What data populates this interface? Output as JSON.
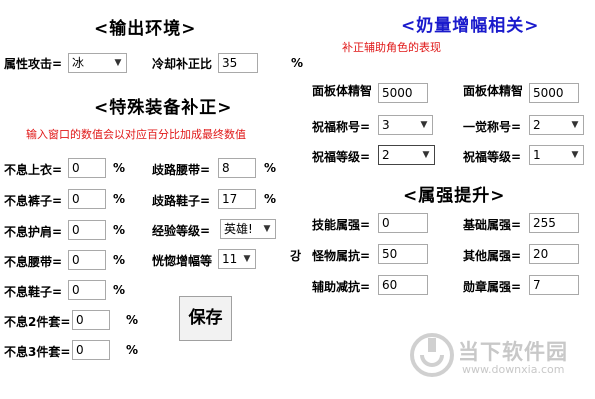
{
  "left": {
    "output_env_title": "<输出环境>",
    "attr_attack_label": "属性攻击=",
    "attr_attack_value": "冰",
    "cooldown_label": "冷却补正比",
    "cooldown_value": "35",
    "cooldown_unit": "%",
    "special_title": "<特殊装备补正>",
    "hint": "输入窗口的数值会以对应百分比加成最终数值",
    "rows": [
      {
        "label": "不息上衣=",
        "value": "0",
        "unit": "%"
      },
      {
        "label": "不息裤子=",
        "value": "0",
        "unit": "%"
      },
      {
        "label": "不息护肩=",
        "value": "0",
        "unit": "%"
      },
      {
        "label": "不息腰带=",
        "value": "0",
        "unit": "%"
      },
      {
        "label": "不息鞋子=",
        "value": "0",
        "unit": "%"
      },
      {
        "label": "不息2件套=",
        "value": "0",
        "unit": "%"
      },
      {
        "label": "不息3件套=",
        "value": "0",
        "unit": "%"
      }
    ],
    "belt_label": "歧路腰带=",
    "belt_value": "8",
    "belt_unit": "%",
    "shoes_label": "歧路鞋子=",
    "shoes_value": "17",
    "shoes_unit": "%",
    "exp_label": "经验等级=",
    "exp_value": "英雄!",
    "amp_label": "恍惚增幅等",
    "amp_value": "11",
    "stray_char": "강",
    "save_label": "保存"
  },
  "right": {
    "buff_title": "<奶量增幅相关>",
    "buff_sub": "补正辅助角色的表现",
    "panel_int_label_1": "面板体精智",
    "panel_int_value_1": "5000",
    "panel_int_label_2": "面板体精智",
    "panel_int_value_2": "5000",
    "title_label_1": "祝福称号=",
    "title_value_1": "3",
    "title_label_2": "一觉称号=",
    "title_value_2": "2",
    "level_label_1": "祝福等级=",
    "level_value_1": "2",
    "level_label_2": "祝福等级=",
    "level_value_2": "1",
    "element_title": "<属强提升>",
    "skill_elem_label": "技能属强=",
    "skill_elem_value": "0",
    "base_elem_label": "基础属强=",
    "base_elem_value": "255",
    "monster_res_label": "怪物属抗=",
    "monster_res_value": "50",
    "other_elem_label": "其他属强=",
    "other_elem_value": "20",
    "aux_res_label": "辅助减抗=",
    "aux_res_value": "60",
    "badge_elem_label": "勋章属强=",
    "badge_elem_value": "7"
  },
  "watermark": {
    "text": "当下软件园",
    "url": "www.downxia.com"
  },
  "colors": {
    "red_hint": "#e01818",
    "blue_title": "#1a1acc",
    "blue_title_2": "#3a5fd0",
    "watermark": "#c8c8c8"
  }
}
